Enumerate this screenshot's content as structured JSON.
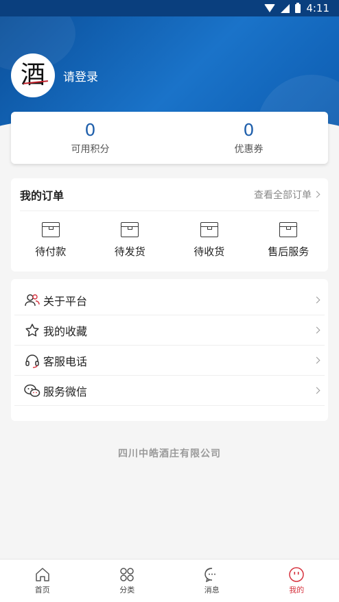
{
  "status_bar": {
    "time": "4:11"
  },
  "header": {
    "login_text": "请登录",
    "avatar_logo": "酒"
  },
  "stats": [
    {
      "value": "0",
      "label": "可用积分"
    },
    {
      "value": "0",
      "label": "优惠券"
    }
  ],
  "orders": {
    "title": "我的订单",
    "view_all": "查看全部订单",
    "items": [
      {
        "label": "待付款",
        "icon": "box-icon"
      },
      {
        "label": "待发货",
        "icon": "box-icon"
      },
      {
        "label": "待收货",
        "icon": "box-icon"
      },
      {
        "label": "售后服务",
        "icon": "box-icon"
      }
    ]
  },
  "menu": [
    {
      "label": "关于平台",
      "icon": "users-icon"
    },
    {
      "label": "我的收藏",
      "icon": "star-icon"
    },
    {
      "label": "客服电话",
      "icon": "headset-icon"
    },
    {
      "label": "服务微信",
      "icon": "wechat-icon"
    }
  ],
  "company": "四川中皓酒庄有限公司",
  "bottom_nav": [
    {
      "label": "首页",
      "icon": "home-icon"
    },
    {
      "label": "分类",
      "icon": "category-icon"
    },
    {
      "label": "消息",
      "icon": "message-icon"
    },
    {
      "label": "我的",
      "icon": "profile-icon",
      "active": true
    }
  ],
  "colors": {
    "header_blue": "#0d5cb0",
    "accent_blue": "#1f5fab",
    "active_red": "#d6323e"
  }
}
